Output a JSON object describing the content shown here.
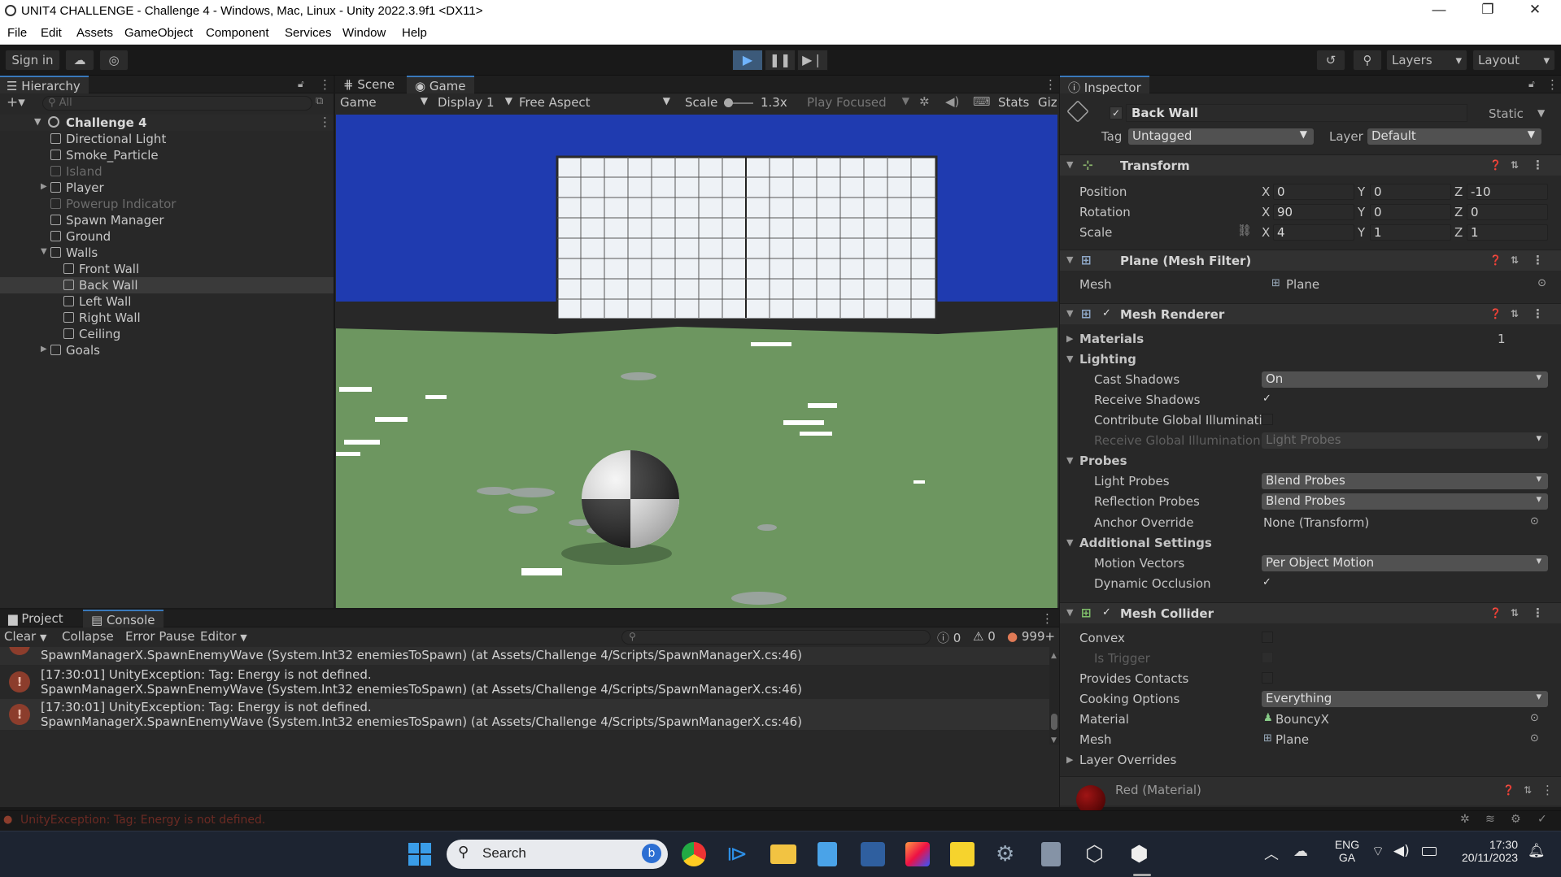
{
  "window": {
    "title": "UNIT4 CHALLENGE - Challenge 4 - Windows, Mac, Linux - Unity 2022.3.9f1 <DX11>"
  },
  "menu": [
    "File",
    "Edit",
    "Assets",
    "GameObject",
    "Component",
    "Services",
    "Window",
    "Help"
  ],
  "toolbar": {
    "sign_in": "Sign in",
    "layers": "Layers",
    "layout": "Layout"
  },
  "hierarchy": {
    "tab": "Hierarchy",
    "search_placeholder": "All",
    "scene": "Challenge 4",
    "items": [
      {
        "label": "Directional Light",
        "depth": 1,
        "state": "normal"
      },
      {
        "label": "Smoke_Particle",
        "depth": 1,
        "state": "normal"
      },
      {
        "label": "Island",
        "depth": 1,
        "state": "dim"
      },
      {
        "label": "Player",
        "depth": 1,
        "state": "normal",
        "expandable": true
      },
      {
        "label": "Powerup Indicator",
        "depth": 1,
        "state": "dim"
      },
      {
        "label": "Spawn Manager",
        "depth": 1,
        "state": "normal"
      },
      {
        "label": "Ground",
        "depth": 1,
        "state": "normal"
      },
      {
        "label": "Walls",
        "depth": 1,
        "state": "normal",
        "expanded": true
      },
      {
        "label": "Front Wall",
        "depth": 2,
        "state": "normal"
      },
      {
        "label": "Back Wall",
        "depth": 2,
        "state": "selected"
      },
      {
        "label": "Left Wall",
        "depth": 2,
        "state": "normal"
      },
      {
        "label": "Right Wall",
        "depth": 2,
        "state": "normal"
      },
      {
        "label": "Ceiling",
        "depth": 2,
        "state": "normal"
      },
      {
        "label": "Goals",
        "depth": 1,
        "state": "normal",
        "expandable": true
      }
    ]
  },
  "game_view": {
    "tabs": [
      "Scene",
      "Game"
    ],
    "game_dropdown": "Game",
    "display": "Display 1",
    "aspect": "Free Aspect",
    "scale_label": "Scale",
    "scale_value": "1.3x",
    "play_focused": "Play Focused",
    "stats": "Stats",
    "gizmos": "Giz"
  },
  "console": {
    "tabs": [
      "Project",
      "Console"
    ],
    "buttons": [
      "Clear",
      "Collapse",
      "Error Pause",
      "Editor"
    ],
    "counts": {
      "info": "0",
      "warn": "0",
      "error": "999+"
    },
    "partial_line": "SpawnManagerX.SpawnEnemyWave (System.Int32 enemiesToSpawn) (at Assets/Challenge 4/Scripts/SpawnManagerX.cs:46)",
    "messages": [
      {
        "line1": "[17:30:01] UnityException: Tag: Energy is not defined.",
        "line2": "SpawnManagerX.SpawnEnemyWave (System.Int32 enemiesToSpawn) (at Assets/Challenge 4/Scripts/SpawnManagerX.cs:46)"
      },
      {
        "line1": "[17:30:01] UnityException: Tag: Energy is not defined.",
        "line2": "SpawnManagerX.SpawnEnemyWave (System.Int32 enemiesToSpawn) (at Assets/Challenge 4/Scripts/SpawnManagerX.cs:46)"
      }
    ],
    "status": "UnityException: Tag: Energy is not defined."
  },
  "inspector": {
    "tab": "Inspector",
    "object_name": "Back Wall",
    "static_label": "Static",
    "tag_label": "Tag",
    "tag_value": "Untagged",
    "layer_label": "Layer",
    "layer_value": "Default",
    "transform": {
      "title": "Transform",
      "position": {
        "label": "Position",
        "x": "0",
        "y": "0",
        "z": "-10"
      },
      "rotation": {
        "label": "Rotation",
        "x": "90",
        "y": "0",
        "z": "0"
      },
      "scale": {
        "label": "Scale",
        "x": "4",
        "y": "1",
        "z": "1"
      }
    },
    "mesh_filter": {
      "title": "Plane (Mesh Filter)",
      "mesh_label": "Mesh",
      "mesh_value": "Plane"
    },
    "mesh_renderer": {
      "title": "Mesh Renderer",
      "materials_label": "Materials",
      "materials_count": "1",
      "lighting": "Lighting",
      "cast_shadows_label": "Cast Shadows",
      "cast_shadows_value": "On",
      "receive_shadows_label": "Receive Shadows",
      "contribute_gi_label": "Contribute Global Illuminatic",
      "receive_gi_label": "Receive Global Illumination",
      "receive_gi_value": "Light Probes",
      "probes": "Probes",
      "light_probes_label": "Light Probes",
      "light_probes_value": "Blend Probes",
      "reflection_probes_label": "Reflection Probes",
      "reflection_probes_value": "Blend Probes",
      "anchor_override_label": "Anchor Override",
      "anchor_override_value": "None (Transform)",
      "additional_settings": "Additional Settings",
      "motion_vectors_label": "Motion Vectors",
      "motion_vectors_value": "Per Object Motion",
      "dynamic_occlusion_label": "Dynamic Occlusion"
    },
    "mesh_collider": {
      "title": "Mesh Collider",
      "convex_label": "Convex",
      "is_trigger_label": "Is Trigger",
      "provides_contacts_label": "Provides Contacts",
      "cooking_options_label": "Cooking Options",
      "cooking_options_value": "Everything",
      "material_label": "Material",
      "material_value": "BouncyX",
      "mesh_label": "Mesh",
      "mesh_value": "Plane",
      "layer_overrides": "Layer Overrides"
    },
    "material": {
      "title": "Red (Material)"
    }
  },
  "taskbar": {
    "search": "Search",
    "lang1": "ENG",
    "lang2": "GA",
    "time": "17:30",
    "date": "20/11/2023"
  }
}
